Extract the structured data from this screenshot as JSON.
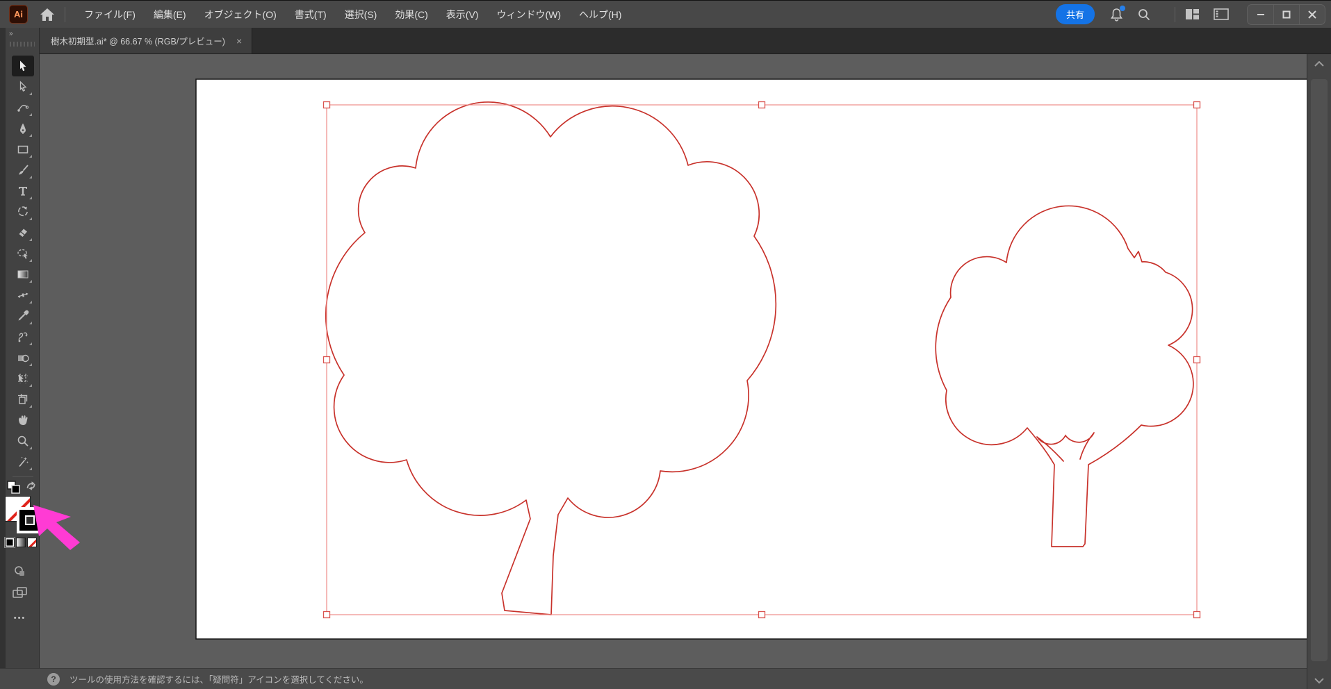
{
  "titlebar": {
    "app_badge": "Ai",
    "menus": [
      "ファイル(F)",
      "編集(E)",
      "オブジェクト(O)",
      "書式(T)",
      "選択(S)",
      "効果(C)",
      "表示(V)",
      "ウィンドウ(W)",
      "ヘルプ(H)"
    ],
    "share_label": "共有",
    "icons": {
      "bell": "notifications",
      "search": "search",
      "workspace": "workspace-switcher",
      "panels": "arrange-documents"
    },
    "window_controls": {
      "minimize": "minimize",
      "maximize": "maximize",
      "close": "close"
    }
  },
  "tabbar": {
    "overflow_chevrons": "»",
    "tab_title": "樹木初期型.ai* @ 66.67 % (RGB/プレビュー)",
    "close_glyph": "×"
  },
  "document": {
    "filename": "樹木初期型.ai",
    "modified": true,
    "zoom_percent": "66.67",
    "color_mode": "RGB",
    "view_mode": "プレビュー"
  },
  "toolbar": {
    "tools": [
      "selection",
      "direct-selection",
      "curvature",
      "pen",
      "rectangle",
      "paintbrush",
      "type",
      "rotate",
      "eraser",
      "shaper",
      "gradient",
      "width",
      "eyedropper",
      "blend",
      "shape-builder",
      "artboard",
      "slice",
      "hand",
      "zoom",
      "magic-wand"
    ],
    "active_tool": "selection",
    "fill_setting": "none",
    "stroke_setting": "color",
    "more_glyph": "•••"
  },
  "canvas": {
    "artboard_color": "#ffffff",
    "selection_handle_count": 8,
    "objects": [
      "large-tree-outline",
      "small-tree-outline"
    ]
  },
  "statusbar": {
    "help_glyph": "?",
    "message": "ツールの使用方法を確認するには、「疑問符」アイコンを選択してください。"
  },
  "colors": {
    "accent_blue": "#1473e6",
    "tree_stroke": "#c8322b",
    "selection_box": "#ee8d88",
    "handle_border": "#d9534f",
    "cursor_magenta": "#ff3bd4",
    "pasteboard": "#5d5d5d",
    "titlebar_bg": "#484848"
  }
}
